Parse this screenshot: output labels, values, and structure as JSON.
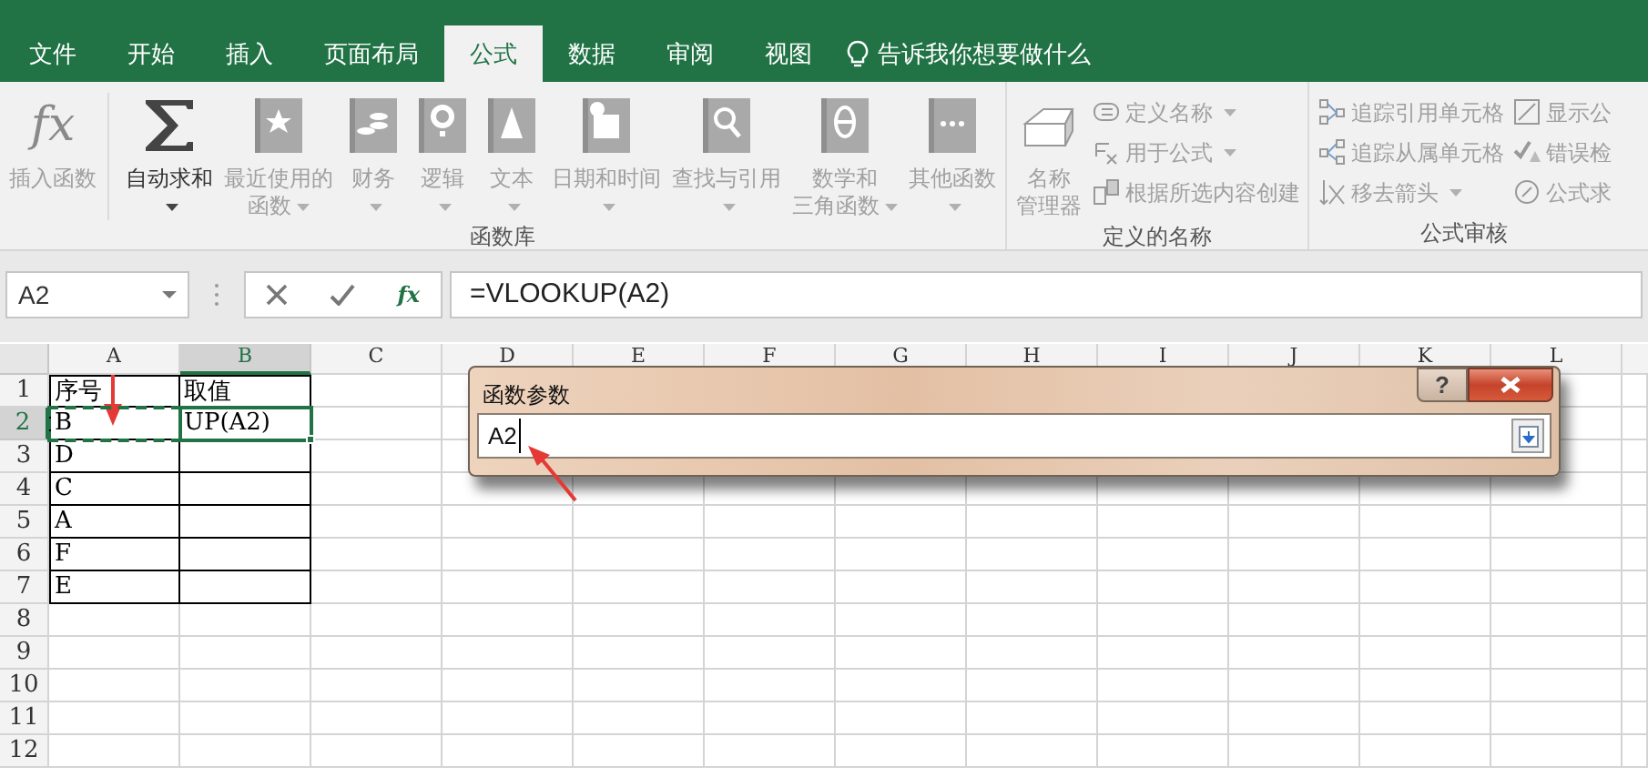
{
  "tabs": [
    {
      "label": "文件",
      "selected": false
    },
    {
      "label": "开始",
      "selected": false
    },
    {
      "label": "插入",
      "selected": false
    },
    {
      "label": "页面布局",
      "selected": false
    },
    {
      "label": "公式",
      "selected": true
    },
    {
      "label": "数据",
      "selected": false
    },
    {
      "label": "审阅",
      "selected": false
    },
    {
      "label": "视图",
      "selected": false
    }
  ],
  "tell_me": "告诉我你想要做什么",
  "ribbon": {
    "groups": [
      {
        "label": "函数库",
        "glyph": "fx",
        "large": [
          {
            "lines": [
              "插入函数"
            ],
            "dropdown": false,
            "disabled": true
          },
          {
            "lines": [
              "自动求和"
            ],
            "dropdown": true,
            "disabled": false
          },
          {
            "lines": [
              "最近使用的",
              "函数"
            ],
            "dropdown": true,
            "disabled": true
          },
          {
            "lines": [
              "财务"
            ],
            "dropdown": true,
            "disabled": true
          },
          {
            "lines": [
              "逻辑"
            ],
            "dropdown": true,
            "disabled": true
          },
          {
            "lines": [
              "文本"
            ],
            "dropdown": true,
            "disabled": true
          },
          {
            "lines": [
              "日期和时间"
            ],
            "dropdown": true,
            "disabled": true
          },
          {
            "lines": [
              "查找与引用"
            ],
            "dropdown": true,
            "disabled": true
          },
          {
            "lines": [
              "数学和",
              "三角函数"
            ],
            "dropdown": true,
            "disabled": true
          },
          {
            "lines": [
              "其他函数"
            ],
            "dropdown": true,
            "disabled": true
          }
        ]
      },
      {
        "label": "定义的名称",
        "large": [
          {
            "lines": [
              "名称",
              "管理器"
            ],
            "dropdown": false,
            "disabled": true
          }
        ],
        "small": [
          [
            {
              "label": "定义名称",
              "dropdown": true,
              "disabled": true
            },
            {
              "label": "用于公式",
              "dropdown": true,
              "disabled": true
            },
            {
              "label": "根据所选内容创建",
              "dropdown": false,
              "disabled": true
            }
          ]
        ]
      },
      {
        "label": "公式审核",
        "small": [
          [
            {
              "label": "追踪引用单元格",
              "dropdown": false,
              "disabled": true
            },
            {
              "label": "追踪从属单元格",
              "dropdown": false,
              "disabled": true
            },
            {
              "label": "移去箭头",
              "dropdown": true,
              "disabled": true
            }
          ],
          [
            {
              "label": "显示公",
              "dropdown": false,
              "disabled": true
            },
            {
              "label": "错误检",
              "dropdown": false,
              "disabled": true
            },
            {
              "label": "公式求",
              "dropdown": false,
              "disabled": true
            }
          ]
        ]
      }
    ]
  },
  "formula_bar": {
    "name_box": "A2",
    "function_button": "fx",
    "formula": "=VLOOKUP(A2)"
  },
  "sheet": {
    "columns": [
      {
        "label": "A",
        "selected": false
      },
      {
        "label": "B",
        "selected": true
      },
      {
        "label": "C",
        "selected": false
      },
      {
        "label": "D",
        "selected": false
      },
      {
        "label": "E",
        "selected": false
      },
      {
        "label": "F",
        "selected": false
      },
      {
        "label": "G",
        "selected": false
      },
      {
        "label": "H",
        "selected": false
      },
      {
        "label": "I",
        "selected": false
      },
      {
        "label": "J",
        "selected": false
      },
      {
        "label": "K",
        "selected": false
      },
      {
        "label": "L",
        "selected": false
      }
    ],
    "rows": [
      {
        "label": "1",
        "selected": false,
        "cells": [
          {
            "text": "序号",
            "active": false,
            "marquee": false
          },
          {
            "text": "取值",
            "active": false,
            "marquee": false
          }
        ]
      },
      {
        "label": "2",
        "selected": true,
        "cells": [
          {
            "text": "B",
            "active": false,
            "marquee": true
          },
          {
            "text": "UP(A2)",
            "active": true,
            "marquee": false
          }
        ]
      },
      {
        "label": "3",
        "selected": false,
        "cells": [
          {
            "text": "D",
            "active": false,
            "marquee": false
          },
          {
            "active": false,
            "marquee": false
          }
        ]
      },
      {
        "label": "4",
        "selected": false,
        "cells": [
          {
            "text": "C",
            "active": false,
            "marquee": false
          },
          {
            "active": false,
            "marquee": false
          }
        ]
      },
      {
        "label": "5",
        "selected": false,
        "cells": [
          {
            "text": "A",
            "active": false,
            "marquee": false
          },
          {
            "active": false,
            "marquee": false
          }
        ]
      },
      {
        "label": "6",
        "selected": false,
        "cells": [
          {
            "text": "F",
            "active": false,
            "marquee": false
          },
          {
            "active": false,
            "marquee": false
          }
        ]
      },
      {
        "label": "7",
        "selected": false,
        "cells": [
          {
            "text": "E",
            "active": false,
            "marquee": false
          },
          {
            "active": false,
            "marquee": false
          }
        ]
      },
      {
        "label": "8",
        "selected": false
      },
      {
        "label": "9",
        "selected": false
      },
      {
        "label": "10",
        "selected": false
      },
      {
        "label": "11",
        "selected": false
      },
      {
        "label": "12",
        "selected": false
      }
    ]
  },
  "dialog": {
    "title": "函数参数",
    "help_button": "?",
    "value": "A2"
  }
}
